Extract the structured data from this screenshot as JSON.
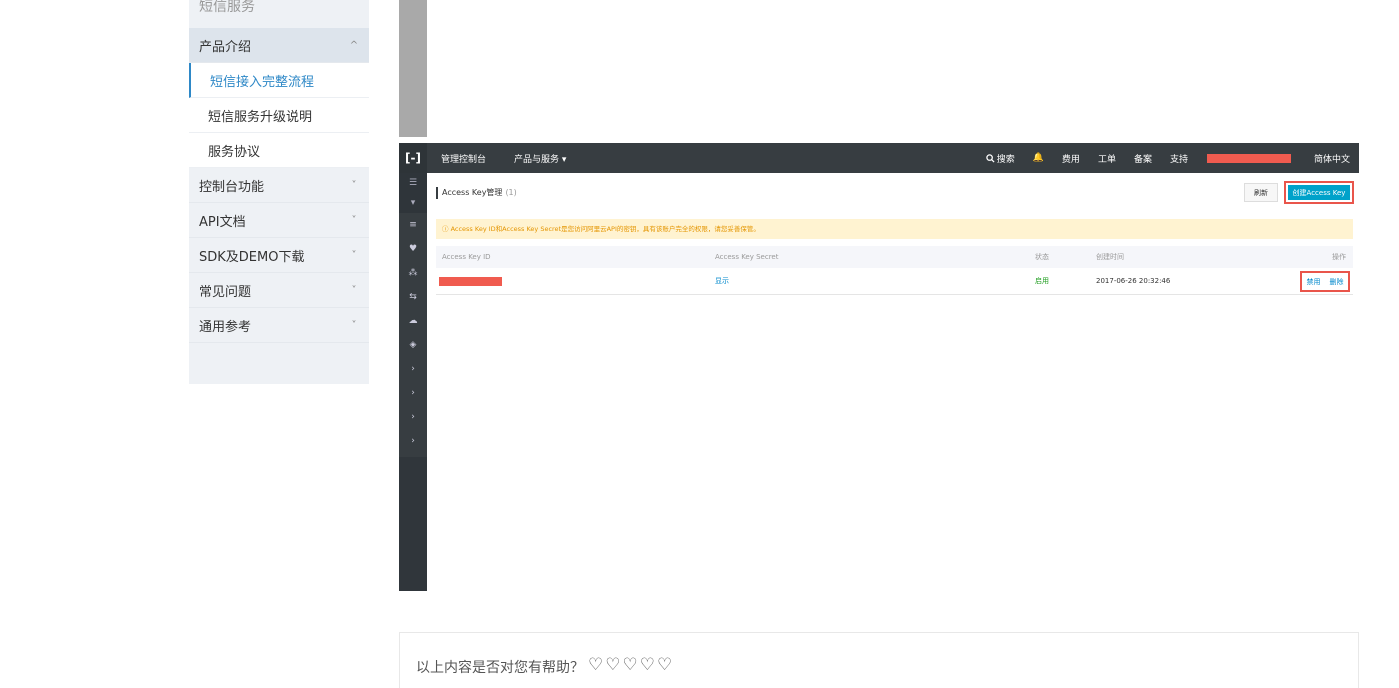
{
  "sidebar": {
    "top_label": "短信服务",
    "items": [
      {
        "label": "产品介绍",
        "chevron": "^"
      },
      {
        "label": "控制台功能",
        "chevron": "˅"
      },
      {
        "label": "API文档",
        "chevron": "˅"
      },
      {
        "label": "SDK及DEMO下载",
        "chevron": "˅"
      },
      {
        "label": "常见问题",
        "chevron": "˅"
      },
      {
        "label": "通用参考",
        "chevron": "˅"
      }
    ],
    "subitems": [
      {
        "label": "短信接入完整流程"
      },
      {
        "label": "短信服务升级说明"
      },
      {
        "label": "服务协议"
      }
    ]
  },
  "console": {
    "topbar": {
      "logo": "[-]",
      "console_label": "管理控制台",
      "products_label": "产品与服务 ▾",
      "search_label": "搜索",
      "bell": "🔔",
      "fees": "费用",
      "ticket": "工单",
      "icp": "备案",
      "support": "支持",
      "lang": "简体中文"
    },
    "leftbar_icons": [
      "☰",
      "▾",
      "≡",
      "♥",
      "⁂",
      "⇆",
      "☁",
      "◈",
      "›",
      "›",
      "›",
      "›"
    ],
    "page_title": "Access Key管理",
    "count": "(1)",
    "refresh": "刷新",
    "create": "创建Access Key",
    "warning": "ⓘ Access Key ID和Access Key Secret是您访问阿里云API的密钥，具有该账户完全的权限，请您妥善保管。",
    "table": {
      "headers": [
        "Access Key ID",
        "Access Key Secret",
        "状态",
        "创建时间",
        "操作"
      ],
      "row": {
        "secret": "显示",
        "status": "启用",
        "created": "2017-06-26 20:32:46",
        "disable": "禁用",
        "delete": "删除"
      }
    }
  },
  "feedback": {
    "question": "以上内容是否对您有帮助？",
    "heart": "♡"
  }
}
